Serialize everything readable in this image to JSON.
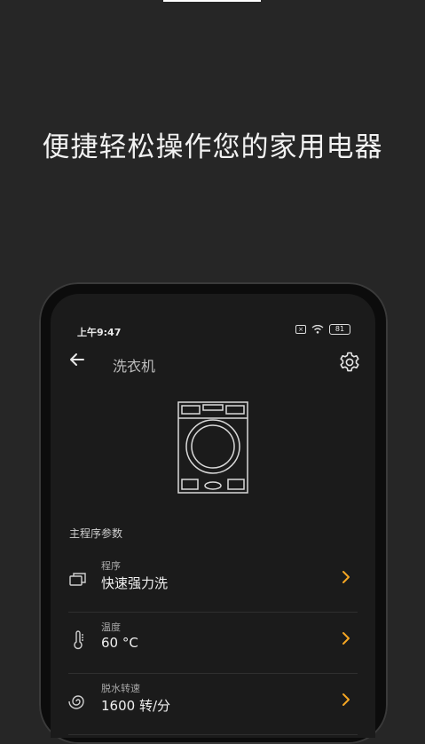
{
  "headline": "便捷轻松操作您的家用电器",
  "status_bar": {
    "time": "上午9:47",
    "battery": "81"
  },
  "app_bar": {
    "title": "洗衣机",
    "back_icon": "arrow-left-icon",
    "settings_icon": "gear-icon"
  },
  "section": {
    "title": "主程序参数"
  },
  "params": [
    {
      "label": "程序",
      "value": "快速强力洗",
      "icon": "program-icon"
    },
    {
      "label": "温度",
      "value": "60 °C",
      "icon": "thermometer-icon"
    },
    {
      "label": "脱水转速",
      "value": "1600 转/分",
      "icon": "spin-icon"
    }
  ],
  "colors": {
    "accent": "#f5a623",
    "background": "#262626",
    "screen": "#1b1b1b"
  }
}
